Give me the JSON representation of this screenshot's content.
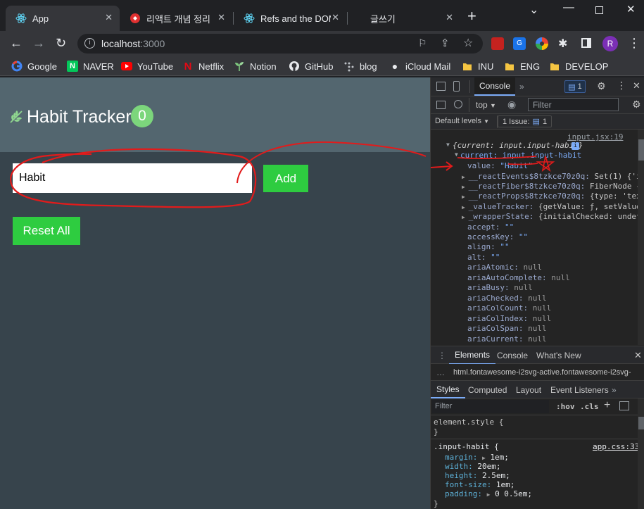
{
  "browser": {
    "tabs": [
      {
        "label": "App",
        "icon": "react-icon",
        "close": "✕"
      },
      {
        "label": "리액트 개념 정리",
        "icon": "notion-icon",
        "close": "✕"
      },
      {
        "label": "Refs and the DOM",
        "icon": "react-icon",
        "close": "✕"
      },
      {
        "label": "글쓰기",
        "icon": "",
        "close": "✕"
      }
    ],
    "new_tab": "+",
    "address": {
      "host": "localhost",
      "port": ":3000"
    },
    "profile_initial": "R",
    "bookmarks": [
      {
        "label": "Google",
        "icon": "google-icon"
      },
      {
        "label": "NAVER",
        "icon": "naver-icon",
        "glyph": "N"
      },
      {
        "label": "YouTube",
        "icon": "youtube-icon"
      },
      {
        "label": "Netflix",
        "icon": "netflix-icon",
        "glyph": "N"
      },
      {
        "label": "Notion",
        "icon": "sprout-icon"
      },
      {
        "label": "GitHub",
        "icon": "github-icon"
      },
      {
        "label": "blog",
        "icon": "dots-icon"
      },
      {
        "label": "iCloud Mail",
        "icon": "apple-icon"
      },
      {
        "label": "INU",
        "icon": "folder-icon"
      },
      {
        "label": "ENG",
        "icon": "folder-icon"
      },
      {
        "label": "DEVELOP",
        "icon": "folder-icon"
      }
    ]
  },
  "app": {
    "title": "Habit Tracker",
    "count": "0",
    "input_value": "Habit",
    "add_label": "Add",
    "reset_label": "Reset All"
  },
  "devtools": {
    "top_tab": "Console",
    "message_count": "1",
    "context": "top",
    "filter_placeholder": "Filter",
    "levels": "Default levels",
    "issues": "1 Issue:",
    "issues_count": "1",
    "source_link": "input.jsx:19",
    "log_summary": "{current: input.input-habit}",
    "current_line": "current: input.input-habit",
    "value_key": "value:",
    "value_val": "\"Habit\"",
    "props": [
      {
        "key": "__reactEvents$8tzkce70z0q:",
        "val": "Set(1) {'i"
      },
      {
        "key": "__reactFiber$8tzkce70z0q:",
        "val": "FiberNode {"
      },
      {
        "key": "__reactProps$8tzkce70z0q:",
        "val": "{type: 'tex"
      },
      {
        "key": "_valueTracker:",
        "val": "{getValue: ƒ, setValue"
      },
      {
        "key": "_wrapperState:",
        "val": "{initialChecked: undef"
      }
    ],
    "attrs": [
      {
        "key": "accept:",
        "val": "\"\""
      },
      {
        "key": "accessKey:",
        "val": "\"\""
      },
      {
        "key": "align:",
        "val": "\"\""
      },
      {
        "key": "alt:",
        "val": "\"\""
      },
      {
        "key": "ariaAtomic:",
        "val": "null"
      },
      {
        "key": "ariaAutoComplete:",
        "val": "null"
      },
      {
        "key": "ariaBusy:",
        "val": "null"
      },
      {
        "key": "ariaChecked:",
        "val": "null"
      },
      {
        "key": "ariaColCount:",
        "val": "null"
      },
      {
        "key": "ariaColIndex:",
        "val": "null"
      },
      {
        "key": "ariaColSpan:",
        "val": "null"
      },
      {
        "key": "ariaCurrent:",
        "val": "null"
      }
    ],
    "drawer_tabs": [
      "Elements",
      "Console",
      "What's New"
    ],
    "breadcrumb": "html.fontawesome-i2svg-active.fontawesome-i2svg-",
    "styles_tabs": [
      "Styles",
      "Computed",
      "Layout",
      "Event Listeners"
    ],
    "styles_filter": "Filter",
    "hov": ":hov",
    "cls": ".cls",
    "element_style": "element.style {",
    "close_brace": "}",
    "rule_selector": ".input-habit {",
    "rule_source": "app.css:33",
    "declarations": [
      {
        "prop": "margin:",
        "val": "1em;",
        "arrow": true
      },
      {
        "prop": "width:",
        "val": "20em;",
        "arrow": false
      },
      {
        "prop": "height:",
        "val": "2.5em;",
        "arrow": false
      },
      {
        "prop": "font-size:",
        "val": "1em;",
        "arrow": false
      },
      {
        "prop": "padding:",
        "val": "0 0.5em;",
        "arrow": true
      }
    ]
  },
  "colors": {
    "annotation": "#e21b1b",
    "accent_green": "#2ecc40",
    "badge_green": "#7cd67c",
    "header": "#53666f",
    "body": "#37444c"
  }
}
